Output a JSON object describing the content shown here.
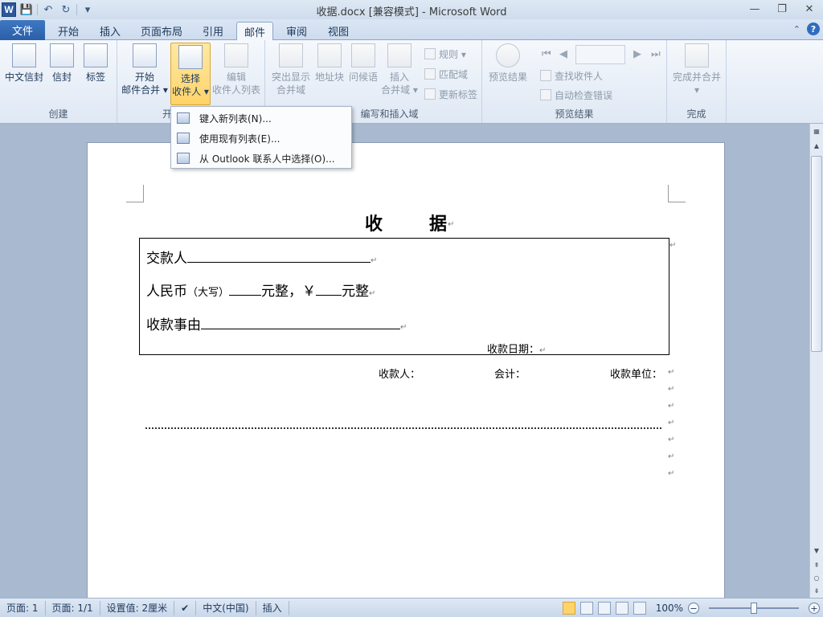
{
  "window": {
    "title": "收据.docx [兼容模式] - Microsoft Word",
    "logo_letter": "W",
    "controls": [
      "—",
      "❐",
      "✕"
    ]
  },
  "qat": {
    "save": "💾",
    "undo": "↶",
    "redo": "↻",
    "more": "▾"
  },
  "tabs": {
    "file": "文件",
    "items": [
      "开始",
      "插入",
      "页面布局",
      "引用",
      "邮件",
      "审阅",
      "视图"
    ],
    "active": "邮件",
    "help": "?",
    "collapse": "⌃"
  },
  "ribbon": {
    "group_create": {
      "label": "创建",
      "buttons": [
        "中文信封",
        "信封",
        "标签"
      ]
    },
    "group_start": {
      "label": "开",
      "start_line1": "开始",
      "start_line2": "邮件合并 ▾",
      "select_line1": "选择",
      "select_line2": "收件人 ▾",
      "edit_line1": "编辑",
      "edit_line2": "收件人列表"
    },
    "group_write": {
      "label": "编写和插入域",
      "highlight_line1": "突出显示",
      "highlight_line2": "合并域",
      "address": "地址块",
      "greeting": "问候语",
      "insert_line1": "插入",
      "insert_line2": "合并域 ▾",
      "rules": "规则 ▾",
      "match": "匹配域",
      "update": "更新标签"
    },
    "group_preview": {
      "label": "预览结果",
      "preview": "预览结果",
      "find": "查找收件人",
      "autocheck": "自动检查错误"
    },
    "group_finish": {
      "label": "完成",
      "finish": "完成并合并",
      "finish_arrow": "▾"
    }
  },
  "dropdown": {
    "items": [
      "键入新列表(N)...",
      "使用现有列表(E)...",
      "从 Outlook 联系人中选择(O)..."
    ]
  },
  "document": {
    "title_left": "收",
    "title_right": "据",
    "payer": "交款人",
    "rmb_label": "人民币",
    "rmb_caps": "（大写）",
    "rmb_yuan": "元整，￥",
    "rmb_yuan2": "元整",
    "reason": "收款事由",
    "date": "收款日期：",
    "receiver": "收款人：",
    "accountant": "会计：",
    "unit": "收款单位：",
    "pilcrow": "↵"
  },
  "statusbar": {
    "page": "页面: 1",
    "pages": "页面: 1/1",
    "setting": "设置值: 2厘米",
    "language": "中文(中国)",
    "mode": "插入",
    "zoom": "100%"
  }
}
